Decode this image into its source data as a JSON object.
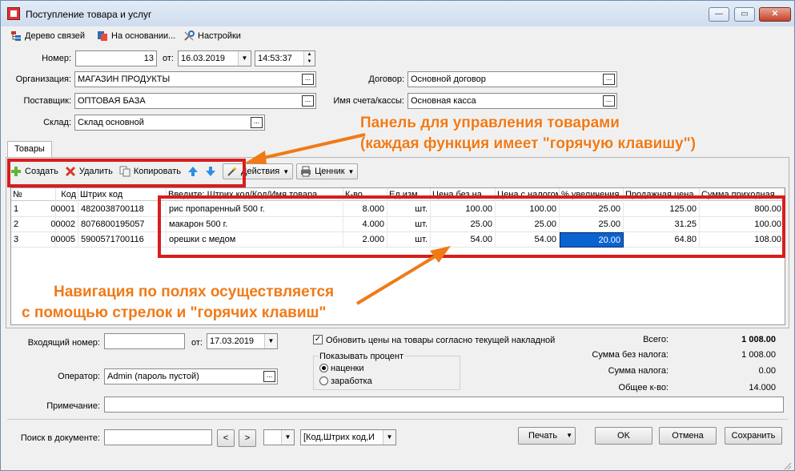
{
  "window": {
    "title": "Поступление товара и услуг",
    "controls": {
      "minimize": "—",
      "maximize": "▭",
      "close": "✕"
    }
  },
  "menubar": [
    {
      "label": "Дерево связей",
      "icon": "tree-icon"
    },
    {
      "label": "На основании...",
      "icon": "based-on-icon"
    },
    {
      "label": "Настройки",
      "icon": "settings-icon"
    }
  ],
  "header": {
    "number_label": "Номер:",
    "number": "13",
    "from_label": "от:",
    "date": "16.03.2019",
    "time": "14:53:37",
    "organization_label": "Организация:",
    "organization": "МАГАЗИН ПРОДУКТЫ",
    "supplier_label": "Поставщик:",
    "supplier": "ОПТОВАЯ БАЗА",
    "warehouse_label": "Склад:",
    "warehouse": "Склад основной",
    "contract_label": "Договор:",
    "contract": "Основной договор",
    "account_label": "Имя счета/кассы:",
    "account": "Основная касса",
    "dots": "..."
  },
  "tabs": {
    "goods": "Товары"
  },
  "toolbar": {
    "create": "Создать",
    "delete": "Удалить",
    "copy": "Копировать",
    "actions": "Действия",
    "price_tag": "Ценник"
  },
  "table": {
    "columns": [
      "№",
      "Код",
      "Штрих код",
      "Введите: Штрих код/Код/Имя товара",
      "К-во",
      "Ед.изм.",
      "Цена без на...",
      "Цена с налогом",
      "% увеличения",
      "Продажная цена",
      "Сумма приходная"
    ],
    "rows": [
      [
        "1",
        "00001",
        "4820038700118",
        "рис пропаренный 500 г.",
        "8.000",
        "шт.",
        "100.00",
        "100.00",
        "25.00",
        "125.00",
        "800.00"
      ],
      [
        "2",
        "00002",
        "8076800195057",
        "макарон 500 г.",
        "4.000",
        "шт.",
        "25.00",
        "25.00",
        "25.00",
        "31.25",
        "100.00"
      ],
      [
        "3",
        "00005",
        "5900571700116",
        "орешки с медом",
        "2.000",
        "шт.",
        "54.00",
        "54.00",
        "20.00",
        "64.80",
        "108.00"
      ]
    ]
  },
  "annotations": {
    "panel_line1": "Панель для управления товарами",
    "panel_line2": "(каждая функция имеет \"горячую клавишу\")",
    "nav_line1": "Навигация по полях осуществляется",
    "nav_line2": "с помощью стрелок и \"горячих клавиш\""
  },
  "footer": {
    "incoming_number_label": "Входящий номер:",
    "incoming_number": "",
    "from_label": "от:",
    "incoming_date": "17.03.2019",
    "update_prices_label": "Обновить цены на товары согласно текущей накладной",
    "update_prices_checked": true,
    "percent_group_label": "Показывать процент",
    "markup_label": "наценки",
    "earnings_label": "заработка",
    "operator_label": "Оператор:",
    "operator": "Admin (пароль пустой)",
    "note_label": "Примечание:",
    "note": "",
    "totals": {
      "total_label": "Всего:",
      "total": "1 008.00",
      "without_tax_label": "Сумма без налога:",
      "without_tax": "1 008.00",
      "tax_label": "Сумма налога:",
      "tax": "0.00",
      "qty_label": "Общее к-во:",
      "qty": "14.000"
    }
  },
  "bottom": {
    "search_label": "Поиск в документе:",
    "search_value": "",
    "prev": "<",
    "next": ">",
    "search_field_select": "[Код,Штрих код,И",
    "print": "Печать",
    "ok": "OK",
    "cancel": "Отмена",
    "save": "Сохранить"
  },
  "colors": {
    "accent": "#f07a17",
    "highlight": "#d81d1d",
    "selection": "#0b62d1"
  }
}
